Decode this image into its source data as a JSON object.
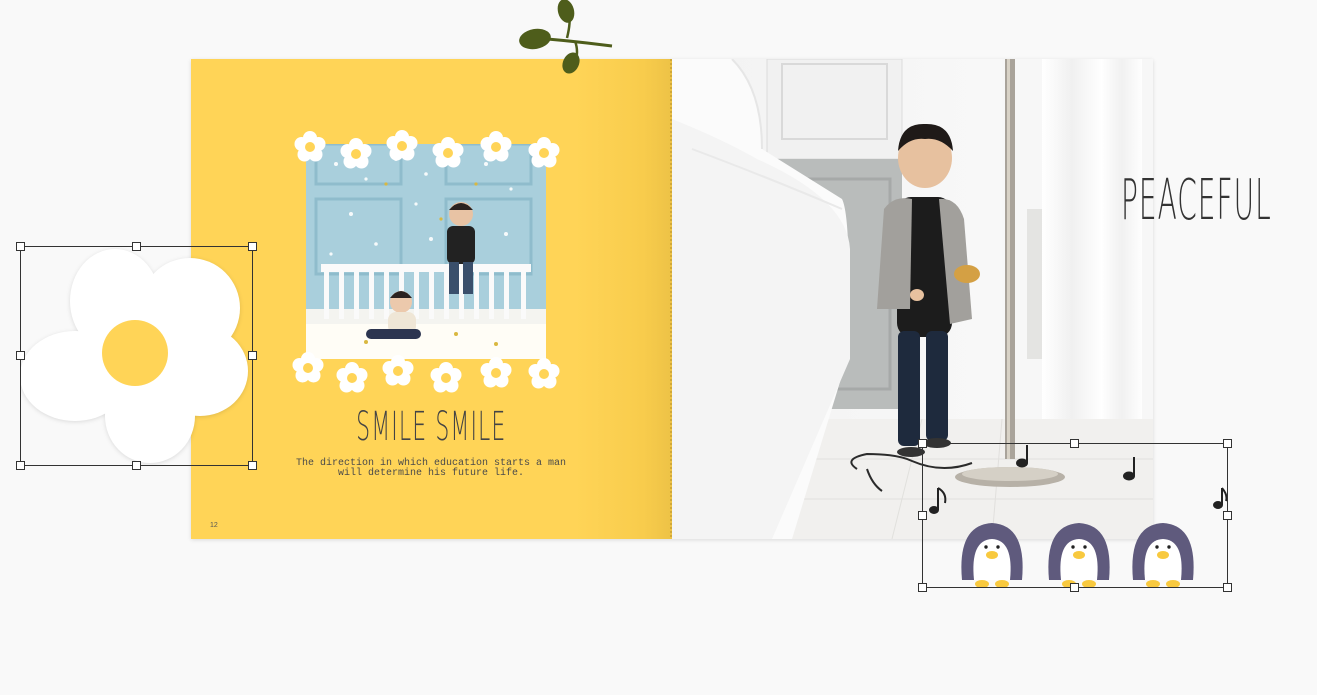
{
  "spread": {
    "left_page": {
      "title": "SMILE SMILE",
      "quote": "The direction in which education starts a man will determine his future life.",
      "page_number": "12",
      "background_color": "#ffd457"
    },
    "right_page": {
      "title": "PEACEFUL"
    }
  },
  "stickers": {
    "flower": {
      "name": "daisy-sticker",
      "petal_color": "#ffffff",
      "center_color": "#ffd457",
      "selected": true
    },
    "penguins": {
      "name": "penguins-with-music-notes-sticker",
      "count": 3,
      "body_color": "#5f5a7d",
      "selected": true
    },
    "leaf": {
      "name": "leaf-branch-sticker",
      "color": "#4e5d1b"
    }
  },
  "colors": {
    "canvas": "#f9f9f9",
    "selection": "#333333"
  }
}
